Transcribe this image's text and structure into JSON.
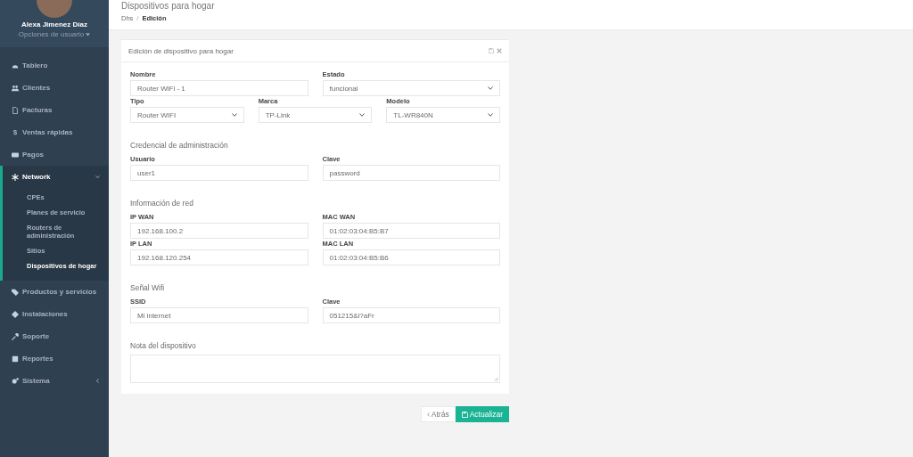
{
  "user": {
    "name": "Alexa Jimenez Díaz",
    "menu": "Opciones de usuario"
  },
  "sidebar": {
    "items": [
      {
        "label": "Tablero",
        "selected": false
      },
      {
        "label": "Clientes",
        "selected": false
      },
      {
        "label": "Facturas",
        "selected": false
      },
      {
        "label": "Ventas rápidas",
        "glyph": "$",
        "selected": false
      },
      {
        "label": "Pagos",
        "selected": false
      },
      {
        "label": "Network",
        "selected": true,
        "expanded": true,
        "children": [
          {
            "label": "CPEs",
            "selected": false
          },
          {
            "label": "Planes de servicio",
            "selected": false
          },
          {
            "label": "Routers de administración",
            "selected": false
          },
          {
            "label": "Sitios",
            "selected": false
          },
          {
            "label": "Dispositivos de hogar",
            "selected": true
          }
        ]
      },
      {
        "label": "Productos y servicios",
        "selected": false
      },
      {
        "label": "Instalaciones",
        "selected": false
      },
      {
        "label": "Soporte",
        "selected": false
      },
      {
        "label": "Reportes",
        "selected": false
      },
      {
        "label": "Sistema",
        "selected": false,
        "expanded": false
      }
    ]
  },
  "page": {
    "title": "Dispositivos para hogar",
    "separator": "/",
    "breadcrumb": [
      {
        "label": "Dhs",
        "selected": false
      },
      {
        "label": "Edición",
        "selected": true
      }
    ]
  },
  "card": {
    "title": "Edición de dispositivo para hogar",
    "sections": [
      {
        "rows": [
          [
            {
              "label": "Nombre",
              "value": "Router WiFi - 1",
              "kind": "input"
            },
            {
              "label": "Estado",
              "value": "funcional",
              "kind": "select"
            }
          ],
          [
            {
              "label": "Tipo",
              "value": "Router WIFI",
              "kind": "select"
            },
            {
              "label": "Marca",
              "value": "TP-Link",
              "kind": "select"
            },
            {
              "label": "Modelo",
              "value": "TL-WR840N",
              "kind": "select"
            }
          ]
        ]
      },
      {
        "heading": "Credencial de administración",
        "rows": [
          [
            {
              "label": "Usuario",
              "value": "user1",
              "kind": "input"
            },
            {
              "label": "Clave",
              "value": "password",
              "kind": "input"
            }
          ]
        ]
      },
      {
        "heading": "Información de red",
        "rows": [
          [
            {
              "label": "IP WAN",
              "value": "192.168.100.2",
              "kind": "input"
            },
            {
              "label": "MAC WAN",
              "value": "01:02:03:04:B5:B7",
              "kind": "input"
            }
          ],
          [
            {
              "label": "IP LAN",
              "value": "192.168.120.254",
              "kind": "input"
            },
            {
              "label": "MAC LAN",
              "value": "01:02:03:04:B5:B6",
              "kind": "input"
            }
          ]
        ]
      },
      {
        "heading": "Señal Wifi",
        "rows": [
          [
            {
              "label": "SSID",
              "value": "Mi internet",
              "kind": "input"
            },
            {
              "label": "Clave",
              "value": "051215&l?aFr",
              "kind": "input"
            }
          ]
        ]
      }
    ],
    "note": {
      "label": "Nota del dispositivo"
    }
  },
  "buttons": {
    "back": "Atrás",
    "submit": "Actualizar"
  }
}
